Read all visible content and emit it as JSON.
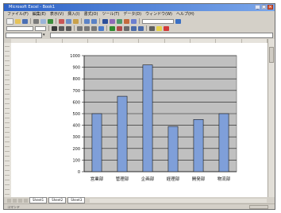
{
  "window": {
    "title": "Microsoft Excel - Book1"
  },
  "menubar": {
    "items": [
      "ファイル(F)",
      "編集(E)",
      "表示(V)",
      "挿入(I)",
      "書式(O)",
      "ツール(T)",
      "データ(D)",
      "ウィンドウ(W)",
      "ヘルプ(H)"
    ]
  },
  "sheet": {
    "tabs": [
      "Sheet1",
      "Sheet2",
      "Sheet3"
    ]
  },
  "status": {
    "text": "コマンド"
  },
  "colors": {
    "bar": "#7f9fd9",
    "plot_area": "#c0c0c0"
  },
  "chart_data": {
    "type": "bar",
    "categories": [
      "営業部",
      "管理部",
      "企画部",
      "経理部",
      "開発部",
      "物流部"
    ],
    "values": [
      500,
      650,
      920,
      390,
      450,
      500
    ],
    "ylim": [
      0,
      1000
    ],
    "yticks": [
      0,
      100,
      200,
      300,
      400,
      500,
      600,
      700,
      800,
      900,
      1000
    ],
    "grid": true,
    "title": "",
    "xlabel": "",
    "ylabel": ""
  }
}
